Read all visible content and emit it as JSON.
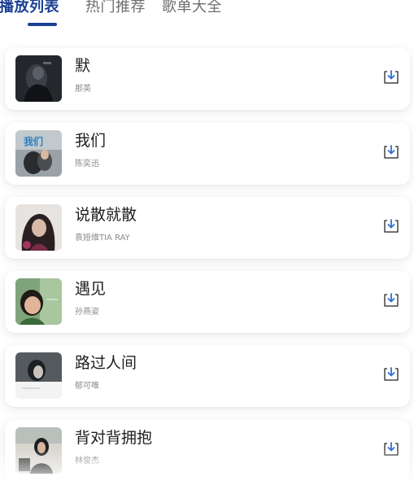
{
  "tabs": [
    {
      "label": "播放列表",
      "active": true
    },
    {
      "label": "热门推荐",
      "active": false
    },
    {
      "label": "歌单大全",
      "active": false
    }
  ],
  "colors": {
    "accent": "#1b3f94",
    "download_icon": "#2f6fd6"
  },
  "songs": [
    {
      "title": "默",
      "artist": "那英",
      "cover_icon": "album-cover-dark"
    },
    {
      "title": "我们",
      "artist": "陈奕迅",
      "cover_icon": "album-cover-blue"
    },
    {
      "title": "说散就散",
      "artist": "袁娅维TIA RAY",
      "cover_icon": "album-cover-portrait"
    },
    {
      "title": "遇见",
      "artist": "孙燕姿",
      "cover_icon": "album-cover-green"
    },
    {
      "title": "路过人间",
      "artist": "郁可唯",
      "cover_icon": "album-cover-grey"
    },
    {
      "title": "背对背拥抱",
      "artist": "林俊杰",
      "cover_icon": "album-cover-street"
    }
  ]
}
